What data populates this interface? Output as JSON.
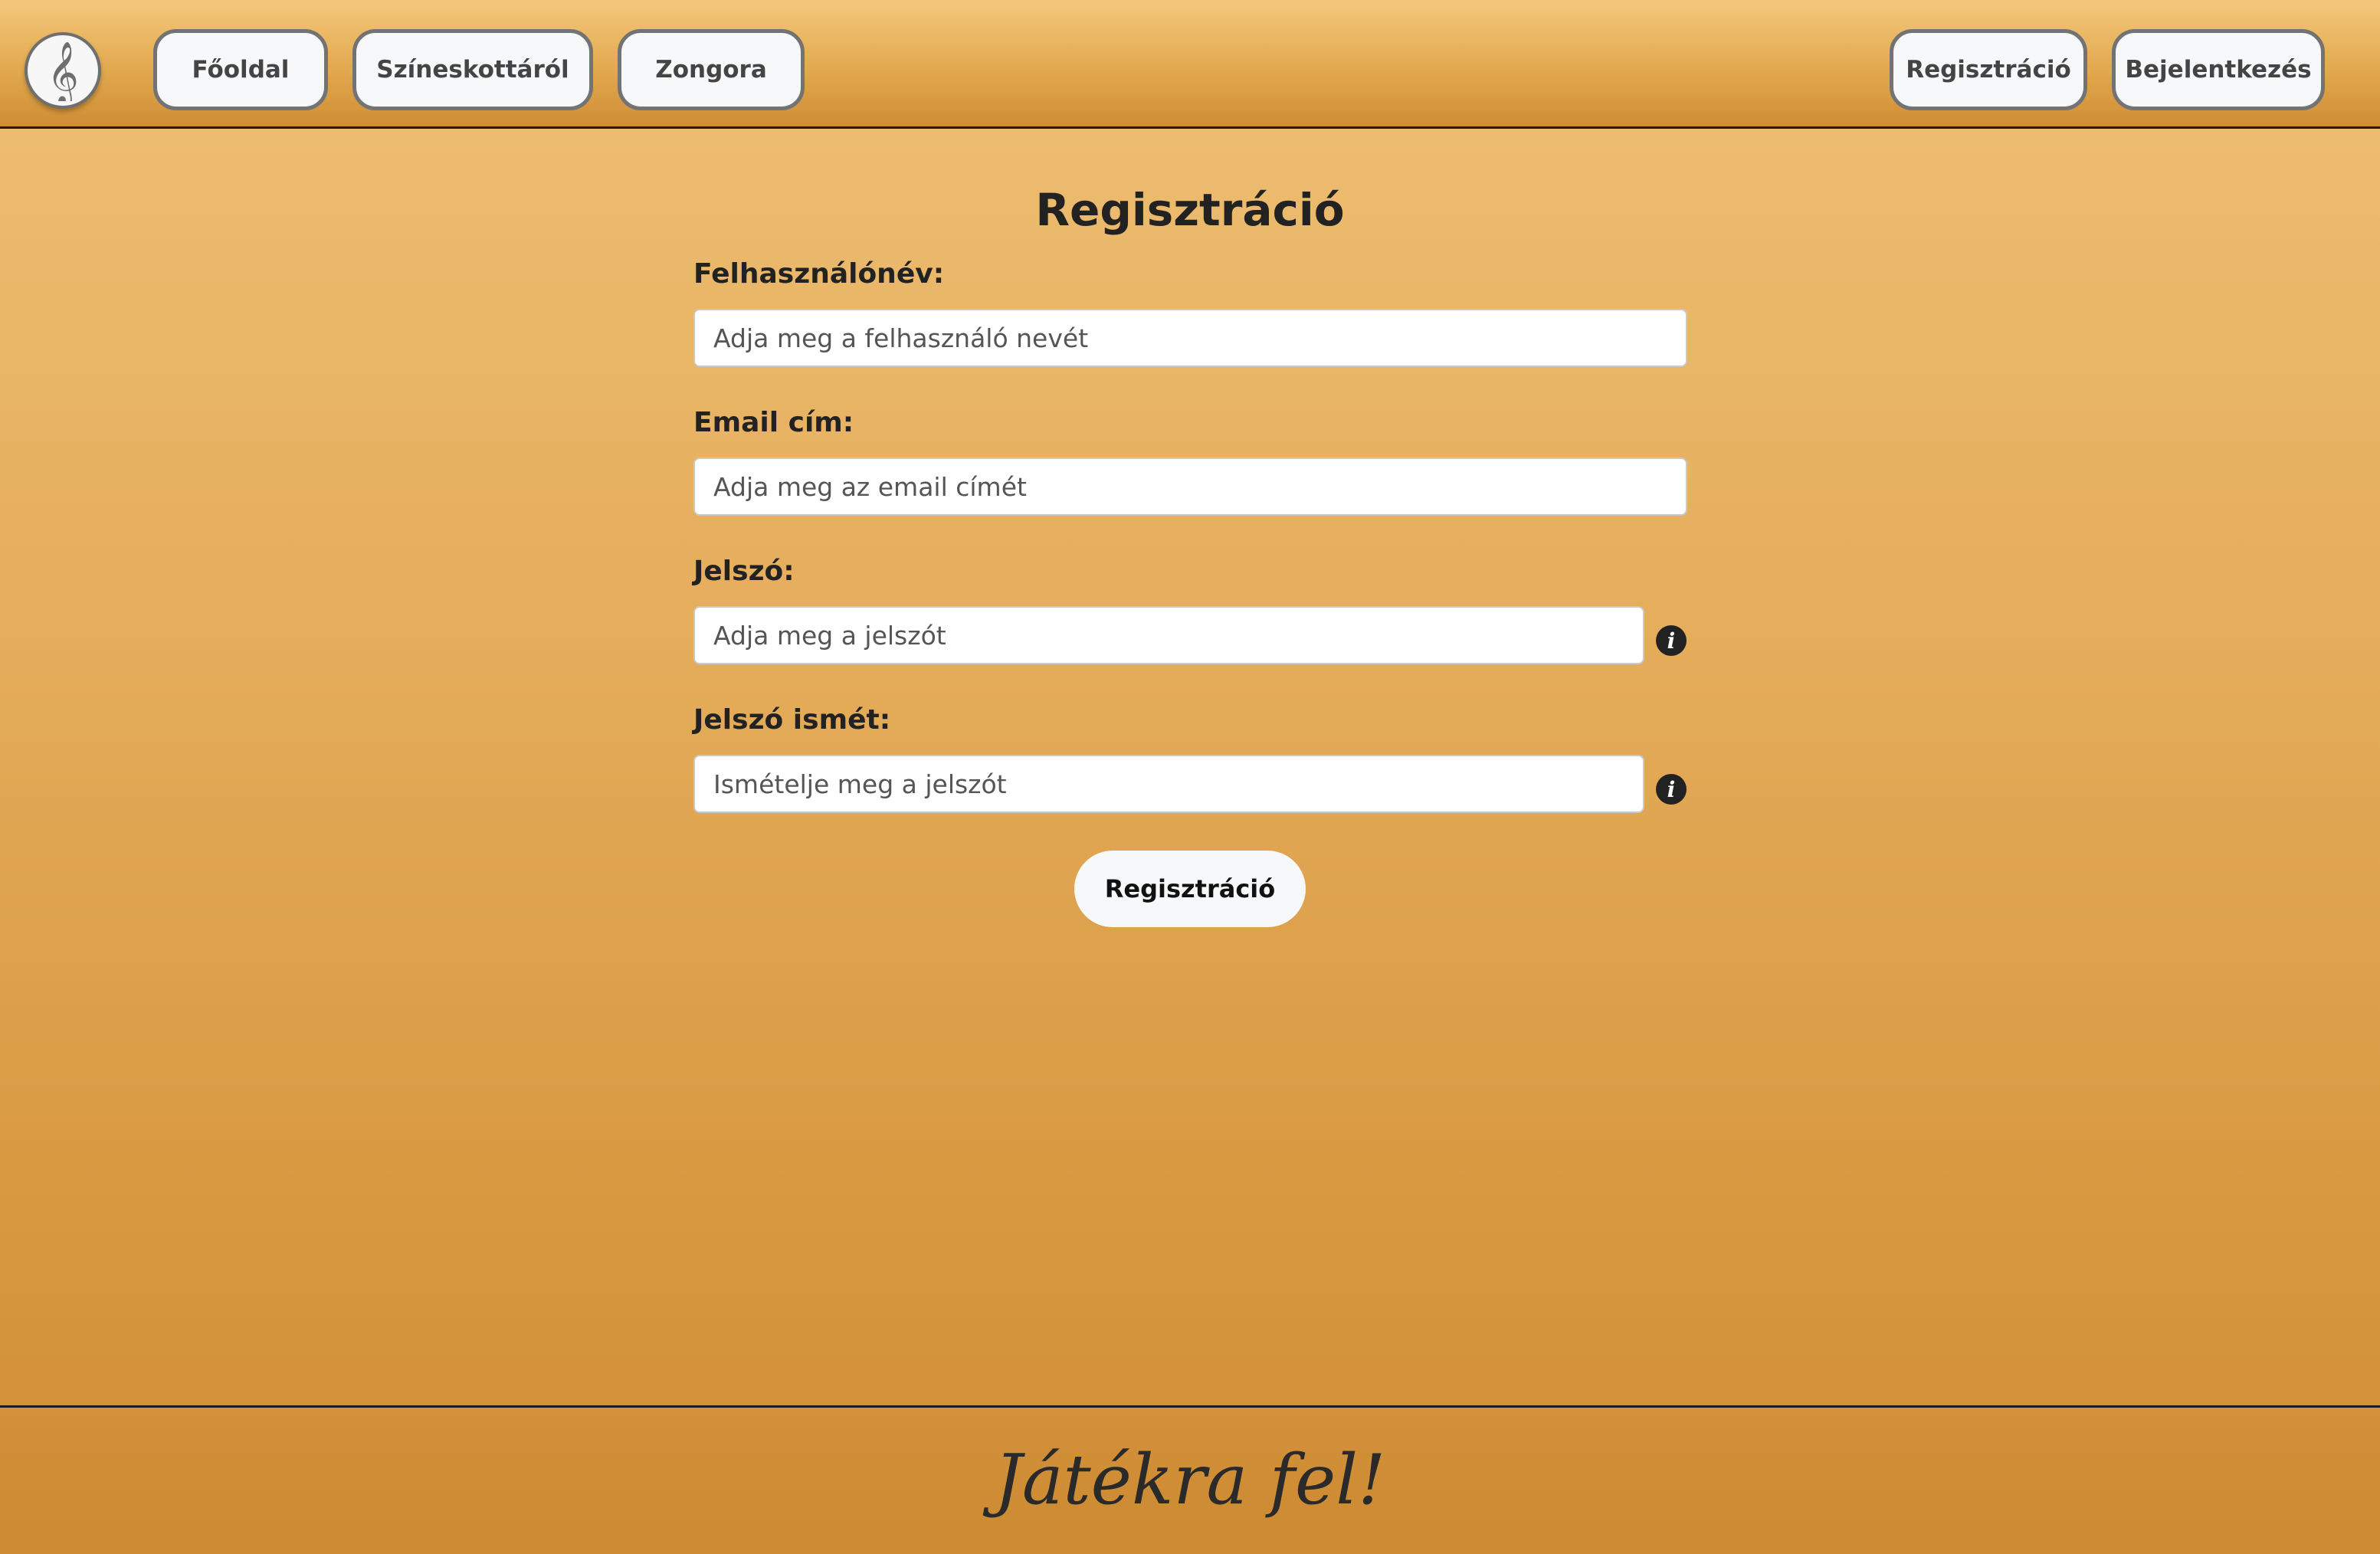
{
  "nav": {
    "logo_icon": "treble-clef-icon",
    "left_links": [
      {
        "label": "Főoldal"
      },
      {
        "label": "Színeskottáról"
      },
      {
        "label": "Zongora"
      }
    ],
    "right_links": [
      {
        "label": "Regisztráció"
      },
      {
        "label": "Bejelentkezés"
      }
    ]
  },
  "form": {
    "title": "Regisztráció",
    "username": {
      "label": "Felhasználónév:",
      "placeholder": "Adja meg a felhasználó nevét",
      "value": ""
    },
    "email": {
      "label": "Email cím:",
      "placeholder": "Adja meg az email címét",
      "value": ""
    },
    "password": {
      "label": "Jelszó:",
      "placeholder": "Adja meg a jelszót",
      "value": "",
      "info_icon": "info-icon"
    },
    "password_repeat": {
      "label": "Jelszó ismét:",
      "placeholder": "Ismételje meg a jelszót",
      "value": "",
      "info_icon": "info-icon"
    },
    "submit_label": "Regisztráció"
  },
  "footer": {
    "text": "Játékra fel!"
  },
  "colors": {
    "background_top": "#eec075",
    "background_bottom": "#cf8d34",
    "button_bg": "#f7f8fa",
    "button_border": "#737373",
    "text_dark": "#222222"
  }
}
